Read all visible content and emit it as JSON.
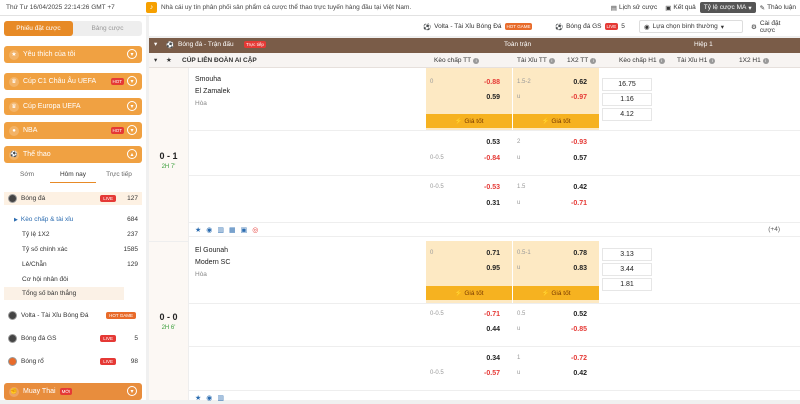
{
  "topbar": {
    "datetime": "Thứ Tư 16/04/2025 22:14:26 GMT +7",
    "marquee": "Nhà cái uy tín phân phối sản phẩm cá cược thể thao trực tuyến hàng đầu tại Việt Nam.",
    "history": "Lịch sử cược",
    "results": "Kết quả",
    "odds_type": "Tỷ lệ cược MA",
    "guide": "Thảo luận"
  },
  "secondbar": {
    "chip1": "Volta - Tài Xỉu Bóng Đá",
    "chip1_badge": "HOT GAME",
    "chip2": "Bóng đá GS",
    "chip2_badge": "LIVE",
    "chip2_count": "5",
    "select": "Lựa chọn bình thường",
    "settings": "Cài đặt cược"
  },
  "sidebar": {
    "tab_active": "Phiếu đặt cược",
    "tab_other": "Bảng cược",
    "favorites": "Yêu thích của tôi",
    "c1": "Cúp C1 Châu Âu UEFA",
    "europa": "Cúp Europa UEFA",
    "nba": "NBA",
    "sports": "Thể thao",
    "hot": "HOT",
    "subtabs": [
      "Sớm",
      "Hôm nay",
      "Trực tiếp"
    ],
    "football": {
      "label": "Bóng đá",
      "badge": "LIVE",
      "count": "127"
    },
    "items": [
      {
        "label": "Kèo chấp & tài xỉu",
        "count": "684"
      },
      {
        "label": "Tỷ lệ 1X2",
        "count": "237"
      },
      {
        "label": "Tỷ số chính xác",
        "count": "1585"
      },
      {
        "label": "Lẻ/Chẵn",
        "count": "129"
      },
      {
        "label": "Cơ hội nhân đôi",
        "count": ""
      },
      {
        "label": "Tổng số bàn thắng",
        "count": ""
      }
    ],
    "volta": {
      "label": "Volta - Tài Xỉu Bóng Đá",
      "badge": "HOT GAME"
    },
    "gs": {
      "label": "Bóng đá GS",
      "badge": "LIVE",
      "count": "5"
    },
    "basket": {
      "label": "Bóng rổ",
      "badge": "LIVE",
      "count": "98"
    },
    "muay": {
      "label": "Muay Thai",
      "badge": "MỚI"
    }
  },
  "table": {
    "sport_title": "Bóng đá - Trận đấu",
    "live_badge": "Trực tiếp",
    "full_match": "Toàn trận",
    "half1": "Hiệp 1",
    "league": "CÚP LIÊN ĐOÀN AI CẬP",
    "cols": [
      "Kèo chấp TT",
      "Tài Xỉu TT",
      "1X2 TT",
      "Kèo chấp H1",
      "Tài Xỉu H1",
      "1X2 H1"
    ],
    "good": "Giá tốt",
    "more": "(+4)"
  },
  "matches": [
    {
      "home": "Smouha",
      "away": "El Zamalek",
      "draw": "Hòa",
      "score": "0 - 1",
      "time": "2H 7'",
      "rows": [
        {
          "hc1": "0",
          "hv1": "-0.88",
          "hc2": "",
          "hv2": "0.59",
          "ou1": "1.5-2",
          "ov1": "0.62",
          "ou2": "u",
          "ov2": "-0.97"
        },
        {
          "hc1": "",
          "hv1": "0.53",
          "hc2": "0-0.5",
          "hv2": "-0.84",
          "ou1": "2",
          "ov1": "-0.93",
          "ou2": "u",
          "ov2": "0.57"
        },
        {
          "hc1": "0-0.5",
          "hv1": "-0.53",
          "hc2": "",
          "hv2": "0.31",
          "ou1": "1.5",
          "ov1": "0.42",
          "ou2": "u",
          "ov2": "-0.71"
        }
      ],
      "x12": [
        "16.75",
        "1.16",
        "4.12"
      ]
    },
    {
      "home": "El Gounah",
      "away": "Modern SC",
      "draw": "Hòa",
      "score": "0 - 0",
      "time": "2H 6'",
      "rows": [
        {
          "hc1": "0",
          "hv1": "0.71",
          "hc2": "",
          "hv2": "0.95",
          "ou1": "0.5-1",
          "ov1": "0.78",
          "ou2": "u",
          "ov2": "0.83"
        },
        {
          "hc1": "0-0.5",
          "hv1": "-0.71",
          "hc2": "",
          "hv2": "0.44",
          "ou1": "0.5",
          "ov1": "0.52",
          "ou2": "u",
          "ov2": "-0.85"
        },
        {
          "hc1": "",
          "hv1": "0.34",
          "hc2": "0-0.5",
          "hv2": "-0.57",
          "ou1": "1",
          "ov1": "-0.72",
          "ou2": "u",
          "ov2": "0.42"
        }
      ],
      "x12": [
        "3.13",
        "3.44",
        "1.81"
      ]
    }
  ]
}
